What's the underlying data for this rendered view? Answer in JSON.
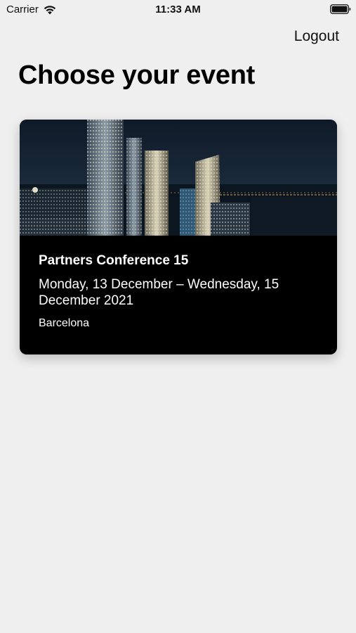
{
  "status_bar": {
    "carrier": "Carrier",
    "time": "11:33 AM",
    "wifi_icon": "wifi-icon",
    "battery_icon": "battery-icon"
  },
  "header": {
    "logout_label": "Logout"
  },
  "main": {
    "title": "Choose your event",
    "events": [
      {
        "name": "Partners Conference 15",
        "dates": "Monday, 13 December – Wednesday, 15 December 2021",
        "location": "Barcelona",
        "image_icon": "city-skyline-night-image"
      }
    ]
  },
  "colors": {
    "background": "#efefef",
    "card_background": "#000000",
    "card_text": "#ffffff"
  }
}
